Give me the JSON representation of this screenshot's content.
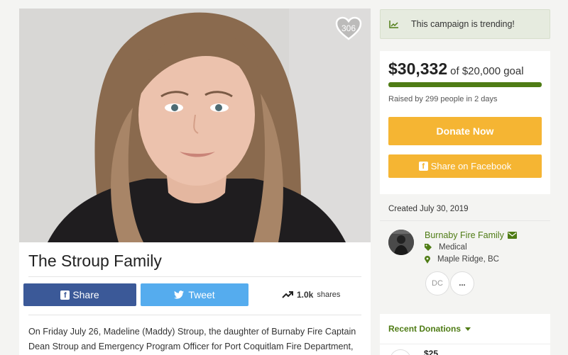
{
  "campaign": {
    "heart_count": "306",
    "title": "The Stroup Family",
    "share_label": "Share",
    "tweet_label": "Tweet",
    "shares_count": "1.0k",
    "shares_label": "shares",
    "story": "On Friday July 26, Madeline (Maddy) Stroup, the daughter of Burnaby Fire Captain Dean Stroup and Emergency Program Officer for Port Coquitlam Fire Department,"
  },
  "sidebar": {
    "trending_text": "This campaign is trending!",
    "amount_raised": "$30,332",
    "goal_text": "of $20,000 goal",
    "progress_fraction": 1.0,
    "raised_by": "Raised by 299 people in 2 days",
    "donate_label": "Donate Now",
    "fb_share_label": "Share on Facebook",
    "created": "Created July 30, 2019",
    "organizer": {
      "name": "Burnaby Fire Family",
      "category": "Medical",
      "location": "Maple Ridge, BC",
      "initials_button": "DC",
      "more_button": "..."
    },
    "recent_donations_label": "Recent Donations",
    "first_donation_amount": "$25"
  },
  "colors": {
    "accent_green": "#4f7c15",
    "donate_orange": "#f5b533",
    "facebook_blue": "#3b5998",
    "twitter_blue": "#55acee"
  },
  "icons": [
    "heart-icon",
    "facebook-icon",
    "twitter-icon",
    "trend-up-icon",
    "chart-icon",
    "email-icon",
    "tag-icon",
    "location-icon",
    "caret-down-icon"
  ]
}
